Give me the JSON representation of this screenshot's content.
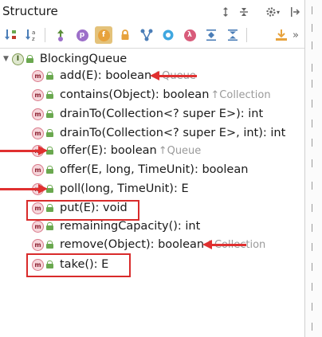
{
  "panel": {
    "title": "Structure"
  },
  "title_toolbar": [
    {
      "name": "expand-all-icon",
      "glyph": "⇕"
    },
    {
      "name": "collapse-all-icon",
      "glyph": "⇔"
    },
    {
      "name": "gear-icon",
      "glyph": "⚙"
    },
    {
      "name": "pin-icon",
      "glyph": "⊣"
    }
  ],
  "toolbar": [
    {
      "name": "sort-by-visibility-icon",
      "glyph": "↓",
      "bg": ""
    },
    {
      "name": "sort-alphabetically-icon",
      "glyph": "a↓",
      "bg": ""
    },
    {
      "name": "show-inherited-icon",
      "glyph": "⇧",
      "bg": "#5b8f3a"
    },
    {
      "name": "show-properties-icon",
      "glyph": "p",
      "bg": "#9c6fc9"
    },
    {
      "name": "show-fields-icon",
      "glyph": "f",
      "bg": "#e7a23c"
    },
    {
      "name": "show-non-public-icon",
      "glyph": "🔒",
      "bg": ""
    },
    {
      "name": "show-lambdas-icon",
      "glyph": "Y",
      "bg": ""
    },
    {
      "name": "show-anonymous-icon",
      "glyph": "◎",
      "bg": ""
    },
    {
      "name": "show-lambda-icon",
      "glyph": "λ",
      "bg": "#d85b7a"
    },
    {
      "name": "expand-icon",
      "glyph": "⇊",
      "bg": ""
    },
    {
      "name": "collapse-icon",
      "glyph": "⇈",
      "bg": ""
    },
    {
      "name": "autoscroll-icon",
      "glyph": "⤓",
      "bg": ""
    }
  ],
  "more": "»",
  "tree": {
    "root": {
      "name": "BlockingQueue",
      "badge": "I"
    },
    "items": [
      {
        "sig": "add(E): boolean",
        "inherited": "↑Queue"
      },
      {
        "sig": "contains(Object): boolean",
        "inherited": "↑Collection"
      },
      {
        "sig": "drainTo(Collection<? super E>): int",
        "inherited": ""
      },
      {
        "sig": "drainTo(Collection<? super E>, int): int",
        "inherited": ""
      },
      {
        "sig": "offer(E): boolean",
        "inherited": "↑Queue"
      },
      {
        "sig": "offer(E, long, TimeUnit): boolean",
        "inherited": ""
      },
      {
        "sig": "poll(long, TimeUnit): E",
        "inherited": ""
      },
      {
        "sig": "put(E): void",
        "inherited": ""
      },
      {
        "sig": "remainingCapacity(): int",
        "inherited": ""
      },
      {
        "sig": "remove(Object): boolean",
        "inherited": "↑Collection"
      },
      {
        "sig": "take(): E",
        "inherited": ""
      }
    ]
  },
  "method_badge": "m",
  "colors": {
    "annotation": "#e03030"
  }
}
